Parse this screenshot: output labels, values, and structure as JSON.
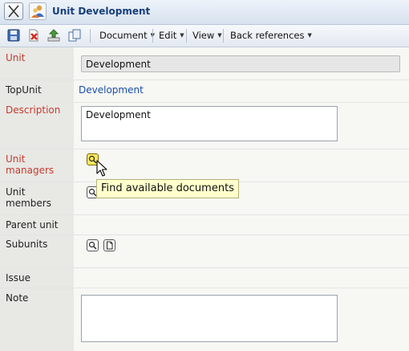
{
  "window": {
    "title": "Unit Development"
  },
  "toolbar": {
    "icons": [
      "save-icon",
      "delete-icon",
      "upload-icon",
      "copy-icon"
    ],
    "menus": [
      "Document",
      "Edit",
      "View",
      "Back references"
    ]
  },
  "form": {
    "unit": {
      "label": "Unit",
      "value": "Development"
    },
    "top_unit": {
      "label": "TopUnit",
      "value": "Development"
    },
    "description": {
      "label": "Description",
      "value": "Development"
    },
    "unit_managers": {
      "label": "Unit managers"
    },
    "unit_members": {
      "label": "Unit members"
    },
    "parent_unit": {
      "label": "Parent unit"
    },
    "subunits": {
      "label": "Subunits"
    },
    "issue": {
      "label": "Issue"
    },
    "note": {
      "label": "Note",
      "value": ""
    }
  },
  "tooltip": {
    "text": "Find available documents"
  },
  "colors": {
    "required_label": "#c43b2f",
    "link": "#1a4fa8",
    "title": "#173f7a",
    "tooltip_bg": "#ffffcc",
    "hover_button": "#f8e85c"
  }
}
